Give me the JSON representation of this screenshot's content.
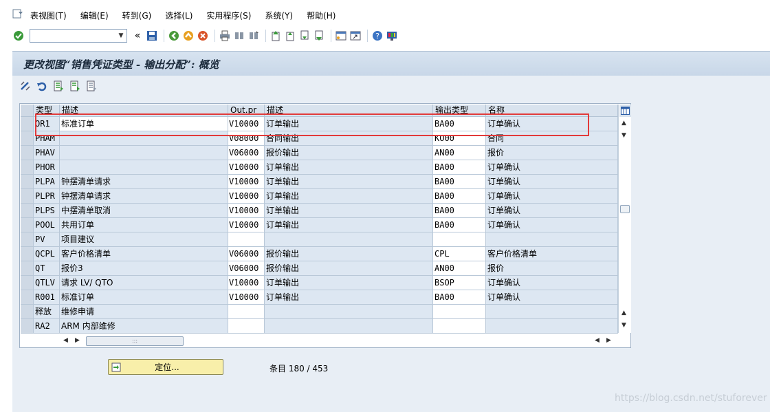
{
  "menubar": {
    "items": [
      "表视图(T)",
      "编辑(E)",
      "转到(G)",
      "选择(L)",
      "实用程序(S)",
      "系统(Y)",
      "帮助(H)"
    ]
  },
  "toolbar": {
    "command_field_value": "",
    "icons": [
      "enter-icon",
      "back-nav-icon",
      "save-icon",
      "back-icon",
      "exit-icon",
      "cancel-icon",
      "print-icon",
      "find-icon",
      "find-next-icon",
      "first-page-icon",
      "prev-page-icon",
      "next-page-icon",
      "last-page-icon",
      "new-session-icon",
      "shortcut-icon",
      "help-icon",
      "customize-layout-icon"
    ]
  },
  "page": {
    "title": "更改视图“销售凭证类型 - 输出分配”: 概览"
  },
  "table": {
    "headers": [
      "类型",
      "描述",
      "Out.pr",
      "描述",
      "输出类型",
      "名称"
    ],
    "rows": [
      [
        "OR1",
        "标准订单",
        "V10000",
        "订单输出",
        "BA00",
        "订单确认"
      ],
      [
        "PHAM",
        "",
        "V08000",
        "合同输出",
        "KO00",
        "合同"
      ],
      [
        "PHAV",
        "",
        "V06000",
        "报价输出",
        "AN00",
        "报价"
      ],
      [
        "PHOR",
        "",
        "V10000",
        "订单输出",
        "BA00",
        "订单确认"
      ],
      [
        "PLPA",
        "钟摆清单请求",
        "V10000",
        "订单输出",
        "BA00",
        "订单确认"
      ],
      [
        "PLPR",
        "钟摆清单请求",
        "V10000",
        "订单输出",
        "BA00",
        "订单确认"
      ],
      [
        "PLPS",
        "中摆清单取消",
        "V10000",
        "订单输出",
        "BA00",
        "订单确认"
      ],
      [
        "POOL",
        "共用订单",
        "V10000",
        "订单输出",
        "BA00",
        "订单确认"
      ],
      [
        "PV",
        "项目建议",
        "",
        "",
        "",
        ""
      ],
      [
        "QCPL",
        "客户价格清单",
        "V06000",
        "报价输出",
        "CPL",
        "客户价格清单"
      ],
      [
        "QT",
        "报价3",
        "V06000",
        "报价输出",
        "AN00",
        "报价"
      ],
      [
        "QTLV",
        "请求 LV/ QTO",
        "V10000",
        "订单输出",
        "BSOP",
        "订单确认"
      ],
      [
        "R001",
        "标准订单",
        "V10000",
        "订单输出",
        "BA00",
        "订单确认"
      ],
      [
        "释放",
        "维修申请",
        "",
        "",
        "",
        ""
      ],
      [
        "RA2",
        "ARM 内部维修",
        "",
        "",
        "",
        ""
      ]
    ]
  },
  "footer": {
    "position_button_label": "定位...",
    "entry_info": "条目 180 / 453"
  },
  "watermark": "https://blog.csdn.net/stuforever"
}
